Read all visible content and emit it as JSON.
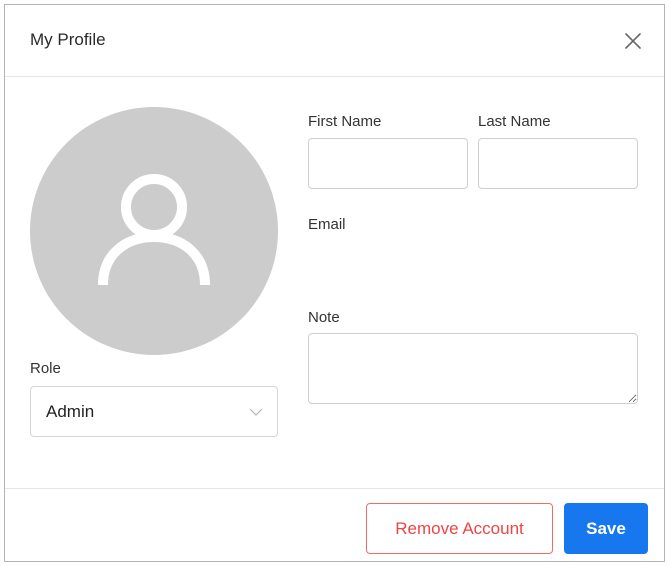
{
  "dialog": {
    "title": "My Profile",
    "close_icon": "close-icon"
  },
  "avatar": {
    "icon": "user-avatar-icon",
    "background": "#cccccc"
  },
  "form": {
    "first_name": {
      "label": "First Name",
      "value": "",
      "placeholder": ""
    },
    "last_name": {
      "label": "Last Name",
      "value": "",
      "placeholder": ""
    },
    "email": {
      "label": "Email"
    },
    "note": {
      "label": "Note",
      "value": ""
    },
    "role": {
      "label": "Role",
      "value": "Admin",
      "chevron_icon": "chevron-down-icon"
    }
  },
  "footer": {
    "remove_label": "Remove Account",
    "save_label": "Save"
  },
  "colors": {
    "primary": "#1677ee",
    "danger": "#ee4444"
  }
}
